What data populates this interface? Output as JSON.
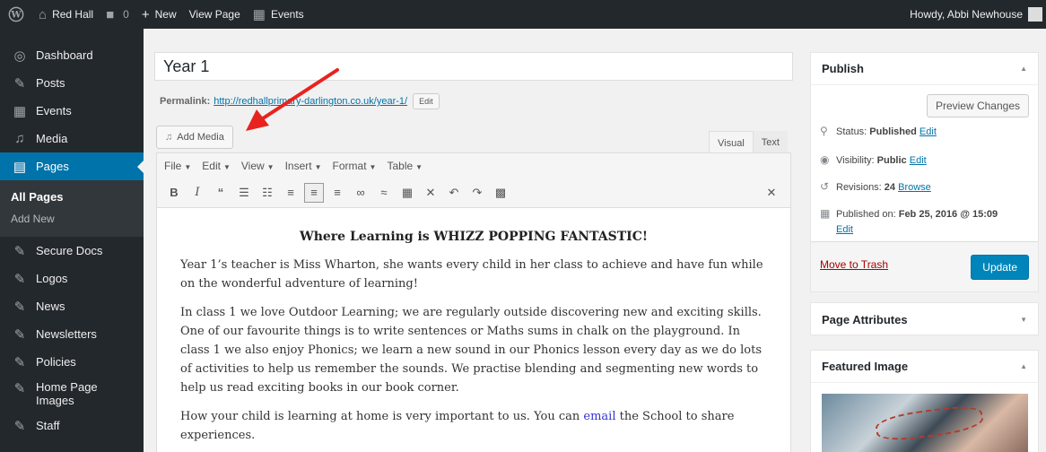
{
  "adminbar": {
    "site_name": "Red Hall",
    "comments_count": "0",
    "new_label": "New",
    "view_page_label": "View Page",
    "events_label": "Events",
    "howdy": "Howdy, Abbi Newhouse"
  },
  "sidebar": {
    "items": [
      {
        "label": "Dashboard",
        "icon": "dashboard-icon"
      },
      {
        "label": "Posts",
        "icon": "pin-icon"
      },
      {
        "label": "Events",
        "icon": "calendar-icon"
      },
      {
        "label": "Media",
        "icon": "media-icon"
      },
      {
        "label": "Pages",
        "icon": "pages-icon"
      },
      {
        "label": "Secure Docs",
        "icon": "pin-icon"
      },
      {
        "label": "Logos",
        "icon": "pin-icon"
      },
      {
        "label": "News",
        "icon": "pin-icon"
      },
      {
        "label": "Newsletters",
        "icon": "pin-icon"
      },
      {
        "label": "Policies",
        "icon": "pin-icon"
      },
      {
        "label": "Home Page Images",
        "icon": "pin-icon"
      },
      {
        "label": "Staff",
        "icon": "pin-icon"
      }
    ],
    "submenu": [
      "All Pages",
      "Add New"
    ]
  },
  "editor": {
    "title": "Year 1",
    "permalink_label": "Permalink:",
    "permalink_url": "http://redhallprimary-darlington.co.uk/year-1/",
    "permalink_edit": "Edit",
    "add_media": "Add Media",
    "tab_visual": "Visual",
    "tab_text": "Text",
    "menus": [
      "File",
      "Edit",
      "View",
      "Insert",
      "Format",
      "Table"
    ],
    "heading": "Where Learning is WHIZZ POPPING FANTASTIC!",
    "para1": "Year 1’s teacher is Miss Wharton, she wants every child in her class to achieve and have fun while on the wonderful adventure of learning!",
    "para2": "In class 1 we love Outdoor Learning; we are regularly outside discovering new and exciting skills. One of our favourite things is to write sentences or Maths sums in chalk on the playground. In class 1 we also enjoy Phonics; we learn a new sound in our Phonics lesson every day as we do lots of activities to help us remember the sounds. We practise blending and segmenting new words to help us read exciting books in our book corner.",
    "para3_before": "How your child is learning at home is very important to us. You can ",
    "para3_link": "email",
    "para3_after": " the School to share experiences."
  },
  "publish": {
    "title": "Publish",
    "preview": "Preview Changes",
    "status_label": "Status: ",
    "status_value": "Published",
    "visibility_label": "Visibility: ",
    "visibility_value": "Public",
    "revisions_label": "Revisions: ",
    "revisions_value": "24",
    "revisions_link": "Browse",
    "published_label": "Published on: ",
    "published_value": "Feb 25, 2016 @ 15:09",
    "edit": "Edit",
    "trash": "Move to Trash",
    "update": "Update"
  },
  "page_attributes": {
    "title": "Page Attributes"
  },
  "featured_image": {
    "title": "Featured Image"
  },
  "colors": {
    "admin_dark": "#23282d",
    "accent_blue": "#0073aa",
    "annotation_red": "#e8231f"
  }
}
